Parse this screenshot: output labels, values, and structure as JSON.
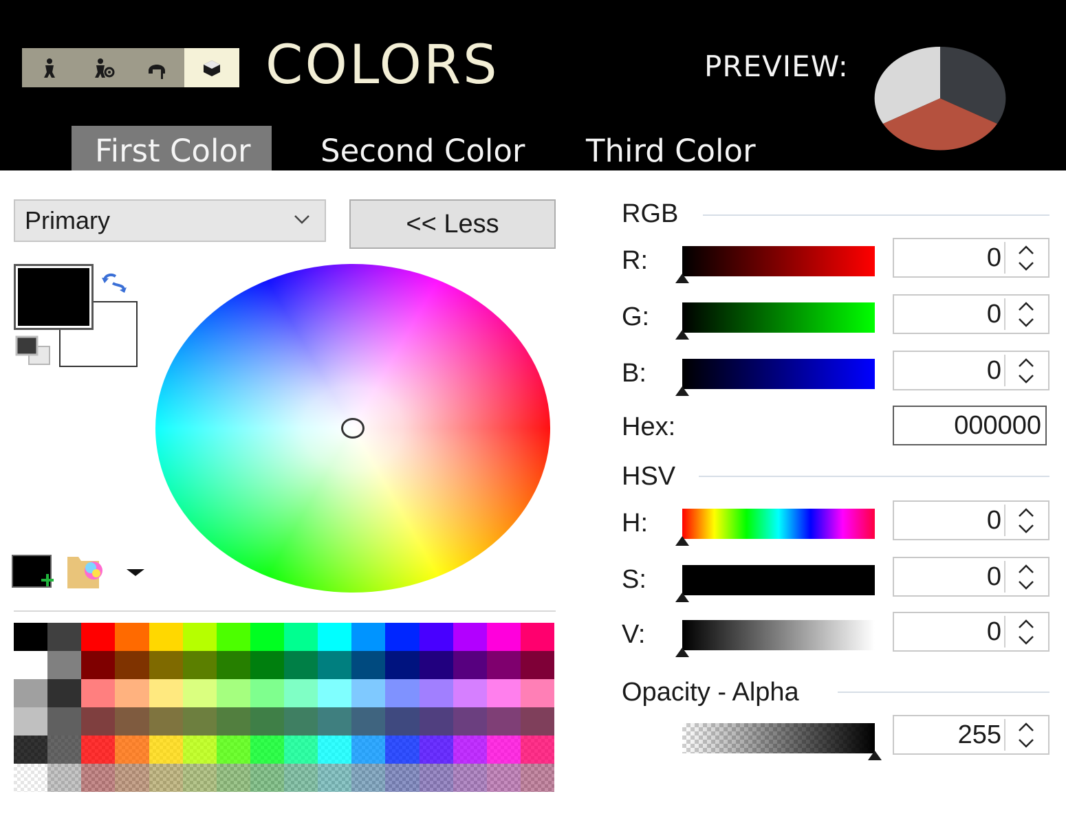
{
  "header": {
    "title": "COLORS",
    "preview_label": "PREVIEW:",
    "steps": [
      "character-icon",
      "character-settings-icon",
      "helmet-info-icon",
      "dye-pot-icon"
    ],
    "tabs": [
      {
        "label": "First Color",
        "active": true
      },
      {
        "label": "Second Color",
        "active": false
      },
      {
        "label": "Third Color",
        "active": false
      }
    ],
    "preview_colors": {
      "first": "#d9d9d9",
      "second": "#3a3d42",
      "third": "#b5513e"
    }
  },
  "left": {
    "mode_value": "Primary",
    "less_label": "<< Less",
    "primary_color": "#000000",
    "secondary_color": "#ffffff"
  },
  "palette": {
    "rows": [
      [
        "#000000",
        "#404040",
        "#ff0000",
        "#ff6a00",
        "#ffd800",
        "#b6ff00",
        "#4cff00",
        "#00ff21",
        "#00ff90",
        "#00ffff",
        "#0094ff",
        "#0026ff",
        "#4800ff",
        "#b200ff",
        "#ff00dc",
        "#ff006e"
      ],
      [
        "#ffffff",
        "#808080",
        "#7f0000",
        "#7f3300",
        "#7f6a00",
        "#5b7f00",
        "#267f00",
        "#007f0e",
        "#007f46",
        "#007f7f",
        "#004a7f",
        "#00137f",
        "#21007f",
        "#57007f",
        "#7f006e",
        "#7f0037"
      ],
      [
        "#a0a0a0",
        "#303030",
        "#ff7f7f",
        "#ffb27f",
        "#ffe97f",
        "#daff7f",
        "#a5ff7f",
        "#7fff8e",
        "#7fffc5",
        "#7fffff",
        "#7fc9ff",
        "#7f92ff",
        "#a17fff",
        "#d67fff",
        "#ff7fed",
        "#ff7fb6"
      ],
      [
        "#c0c0c0",
        "#606060",
        "#7f3f3f",
        "#7f5b3f",
        "#7f743f",
        "#6d7f3f",
        "#527f3f",
        "#3f7f47",
        "#3f7f62",
        "#3f7f7f",
        "#3f647f",
        "#3f497f",
        "#503f7f",
        "#6b3f7f",
        "#7f3f76",
        "#7f3f5b"
      ],
      [
        "#000000",
        "#404040",
        "#ff0000",
        "#ff6a00",
        "#ffd800",
        "#b6ff00",
        "#4cff00",
        "#00ff21",
        "#00ff90",
        "#00ffff",
        "#0094ff",
        "#0026ff",
        "#4800ff",
        "#b200ff",
        "#ff00dc",
        "#ff006e"
      ],
      [
        "#ffffff",
        "#808080",
        "#7f0000",
        "#7f3300",
        "#7f6a00",
        "#5b7f00",
        "#267f00",
        "#007f0e",
        "#007f46",
        "#007f7f",
        "#004a7f",
        "#00137f",
        "#21007f",
        "#57007f",
        "#7f006e",
        "#7f0037"
      ]
    ],
    "translucent_rows": [
      4,
      5
    ]
  },
  "right": {
    "rgb_label": "RGB",
    "hsv_label": "HSV",
    "opacity_label": "Opacity - Alpha",
    "hex_label": "Hex:",
    "hex_value": "000000",
    "channels": {
      "r": {
        "label": "R:",
        "value": "0",
        "level": 0
      },
      "g": {
        "label": "G:",
        "value": "0",
        "level": 0
      },
      "b": {
        "label": "B:",
        "value": "0",
        "level": 0
      },
      "h": {
        "label": "H:",
        "value": "0",
        "level": 0
      },
      "s": {
        "label": "S:",
        "value": "0",
        "level": 0
      },
      "v": {
        "label": "V:",
        "value": "0",
        "level": 0
      },
      "a": {
        "label": "",
        "value": "255",
        "level": 1
      }
    }
  }
}
